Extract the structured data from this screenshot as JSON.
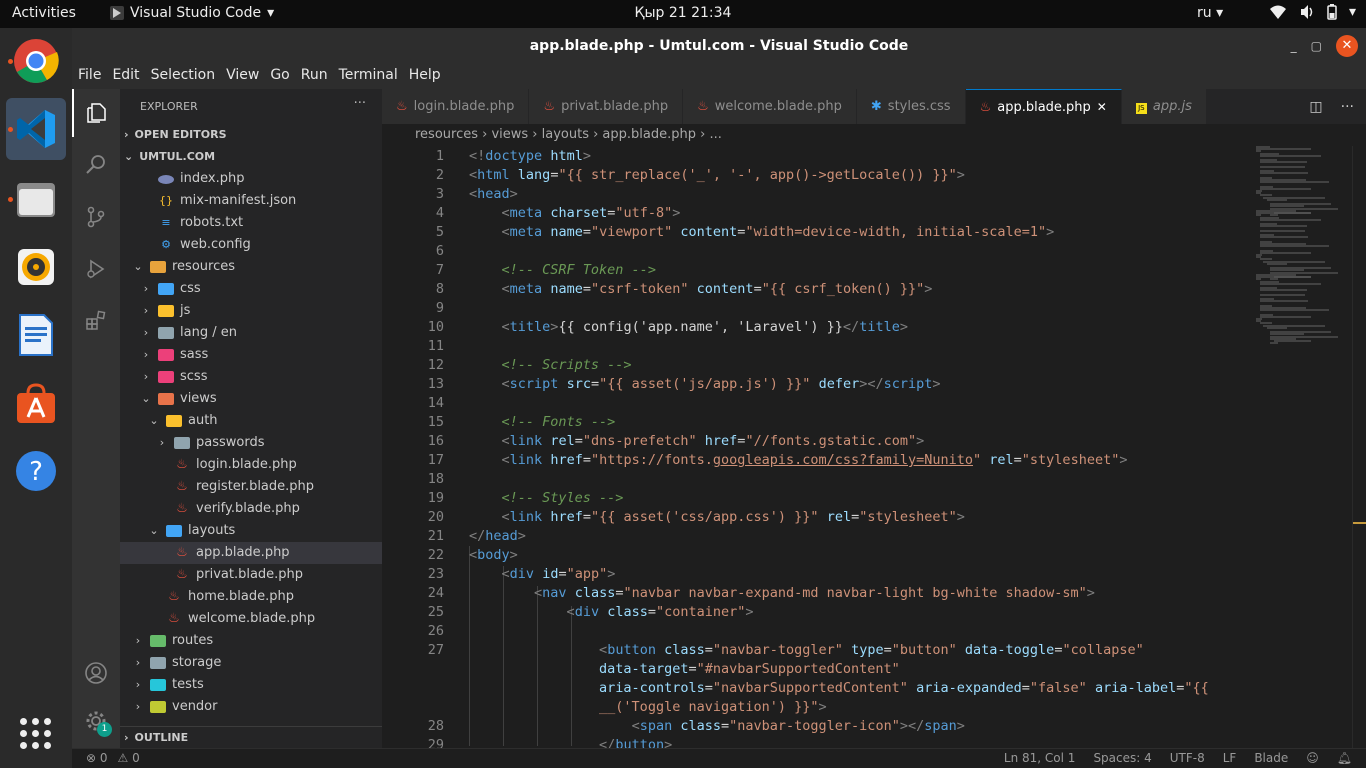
{
  "topbar": {
    "activities": "Activities",
    "app_name": "Visual Studio Code",
    "clock": "Қыр 21  21:34",
    "lang": "ru"
  },
  "window": {
    "title": "app.blade.php - Umtul.com - Visual Studio Code"
  },
  "menu": [
    "File",
    "Edit",
    "Selection",
    "View",
    "Go",
    "Run",
    "Terminal",
    "Help"
  ],
  "sidebar": {
    "header": "EXPLORER",
    "more": "···",
    "open_editors": "OPEN EDITORS",
    "project": "UMTUL.COM",
    "outline": "OUTLINE",
    "settings_badge": "1",
    "tree": [
      {
        "label": "index.php",
        "indent": 1,
        "type": "php"
      },
      {
        "label": "mix-manifest.json",
        "indent": 1,
        "type": "json"
      },
      {
        "label": "robots.txt",
        "indent": 1,
        "type": "txt"
      },
      {
        "label": "web.config",
        "indent": 1,
        "type": "config"
      },
      {
        "label": "resources",
        "indent": 0,
        "type": "folder-open",
        "chev": "down",
        "color": "#e8a33c"
      },
      {
        "label": "css",
        "indent": 1,
        "type": "folder",
        "chev": "right",
        "color": "#42a5f5"
      },
      {
        "label": "js",
        "indent": 1,
        "type": "folder",
        "chev": "right",
        "color": "#fbc02d"
      },
      {
        "label": "lang / en",
        "indent": 1,
        "type": "folder",
        "chev": "right",
        "color": "#90a4ae"
      },
      {
        "label": "sass",
        "indent": 1,
        "type": "folder",
        "chev": "right",
        "color": "#ec407a"
      },
      {
        "label": "scss",
        "indent": 1,
        "type": "folder",
        "chev": "right",
        "color": "#ec407a"
      },
      {
        "label": "views",
        "indent": 1,
        "type": "folder-open",
        "chev": "down",
        "color": "#e8734a"
      },
      {
        "label": "auth",
        "indent": 2,
        "type": "folder-open",
        "chev": "down",
        "color": "#fbc02d"
      },
      {
        "label": "passwords",
        "indent": 3,
        "type": "folder",
        "chev": "right",
        "color": "#90a4ae"
      },
      {
        "label": "login.blade.php",
        "indent": 3,
        "type": "blade"
      },
      {
        "label": "register.blade.php",
        "indent": 3,
        "type": "blade"
      },
      {
        "label": "verify.blade.php",
        "indent": 3,
        "type": "blade"
      },
      {
        "label": "layouts",
        "indent": 2,
        "type": "folder-open",
        "chev": "down",
        "color": "#42a5f5"
      },
      {
        "label": "app.blade.php",
        "indent": 3,
        "type": "blade",
        "selected": true
      },
      {
        "label": "privat.blade.php",
        "indent": 3,
        "type": "blade"
      },
      {
        "label": "home.blade.php",
        "indent": 2,
        "type": "blade"
      },
      {
        "label": "welcome.blade.php",
        "indent": 2,
        "type": "blade"
      },
      {
        "label": "routes",
        "indent": 0,
        "type": "folder",
        "chev": "right",
        "color": "#66bb6a"
      },
      {
        "label": "storage",
        "indent": 0,
        "type": "folder",
        "chev": "right",
        "color": "#90a4ae"
      },
      {
        "label": "tests",
        "indent": 0,
        "type": "folder",
        "chev": "right",
        "color": "#26c6da"
      },
      {
        "label": "vendor",
        "indent": 0,
        "type": "folder",
        "chev": "right",
        "color": "#c0ca33"
      }
    ]
  },
  "tabs": [
    {
      "label": "login.blade.php",
      "icon": "blade"
    },
    {
      "label": "privat.blade.php",
      "icon": "blade"
    },
    {
      "label": "welcome.blade.php",
      "icon": "blade"
    },
    {
      "label": "styles.css",
      "icon": "css"
    },
    {
      "label": "app.blade.php",
      "icon": "blade",
      "active": true
    },
    {
      "label": "app.js",
      "icon": "js",
      "italic": true
    }
  ],
  "breadcrumb": "resources › views › layouts › app.blade.php › ...",
  "code": [
    {
      "n": "1",
      "h": "<span class='p'>&lt;!</span><span class='t'>doctype</span> <span class='a'>html</span><span class='p'>&gt;</span>"
    },
    {
      "n": "2",
      "h": "<span class='p'>&lt;</span><span class='t'>html</span> <span class='a'>lang</span>=<span class='s'>\"{{ str_replace('_', '-', app()-&gt;getLocale()) }}\"</span><span class='p'>&gt;</span>"
    },
    {
      "n": "3",
      "h": "<span class='p'>&lt;</span><span class='t'>head</span><span class='p'>&gt;</span>"
    },
    {
      "n": "4",
      "h": "    <span class='p'>&lt;</span><span class='t'>meta</span> <span class='a'>charset</span>=<span class='s'>\"utf-8\"</span><span class='p'>&gt;</span>"
    },
    {
      "n": "5",
      "h": "    <span class='p'>&lt;</span><span class='t'>meta</span> <span class='a'>name</span>=<span class='s'>\"viewport\"</span> <span class='a'>content</span>=<span class='s'>\"width=device-width, initial-scale=1\"</span><span class='p'>&gt;</span>"
    },
    {
      "n": "6",
      "h": ""
    },
    {
      "n": "7",
      "h": "    <span class='c'>&lt;!-- CSRF Token --&gt;</span>"
    },
    {
      "n": "8",
      "h": "    <span class='p'>&lt;</span><span class='t'>meta</span> <span class='a'>name</span>=<span class='s'>\"csrf-token\"</span> <span class='a'>content</span>=<span class='s'>\"{{ csrf_token() }}\"</span><span class='p'>&gt;</span>"
    },
    {
      "n": "9",
      "h": ""
    },
    {
      "n": "10",
      "h": "    <span class='p'>&lt;</span><span class='t'>title</span><span class='p'>&gt;</span>{{ config('app.name', 'Laravel') }}<span class='p'>&lt;/</span><span class='t'>title</span><span class='p'>&gt;</span>"
    },
    {
      "n": "11",
      "h": ""
    },
    {
      "n": "12",
      "h": "    <span class='c'>&lt;!-- Scripts --&gt;</span>"
    },
    {
      "n": "13",
      "h": "    <span class='p'>&lt;</span><span class='t'>script</span> <span class='a'>src</span>=<span class='s'>\"{{ asset('js/app.js') }}\"</span> <span class='a'>defer</span><span class='p'>&gt;&lt;/</span><span class='t'>script</span><span class='p'>&gt;</span>"
    },
    {
      "n": "14",
      "h": ""
    },
    {
      "n": "15",
      "h": "    <span class='c'>&lt;!-- Fonts --&gt;</span>"
    },
    {
      "n": "16",
      "h": "    <span class='p'>&lt;</span><span class='t'>link</span> <span class='a'>rel</span>=<span class='s'>\"dns-prefetch\"</span> <span class='a'>href</span>=<span class='s'>\"//fonts.gstatic.com\"</span><span class='p'>&gt;</span>"
    },
    {
      "n": "17",
      "h": "    <span class='p'>&lt;</span><span class='t'>link</span> <span class='a'>href</span>=<span class='s'>\"https://fonts.<span class='u'>googleapis.com/css?family=Nunito</span>\"</span> <span class='a'>rel</span>=<span class='s'>\"stylesheet\"</span><span class='p'>&gt;</span>"
    },
    {
      "n": "18",
      "h": ""
    },
    {
      "n": "19",
      "h": "    <span class='c'>&lt;!-- Styles --&gt;</span>"
    },
    {
      "n": "20",
      "h": "    <span class='p'>&lt;</span><span class='t'>link</span> <span class='a'>href</span>=<span class='s'>\"{{ asset('css/app.css') }}\"</span> <span class='a'>rel</span>=<span class='s'>\"stylesheet\"</span><span class='p'>&gt;</span>"
    },
    {
      "n": "21",
      "h": "<span class='p'>&lt;/</span><span class='t'>head</span><span class='p'>&gt;</span>"
    },
    {
      "n": "22",
      "h": "<span class='p'>&lt;</span><span class='t'>body</span><span class='p'>&gt;</span>"
    },
    {
      "n": "23",
      "h": "    <span class='p'>&lt;</span><span class='t'>div</span> <span class='a'>id</span>=<span class='s'>\"app\"</span><span class='p'>&gt;</span>"
    },
    {
      "n": "24",
      "h": "        <span class='p'>&lt;</span><span class='t'>nav</span> <span class='a'>class</span>=<span class='s'>\"navbar navbar-expand-md navbar-light bg-white shadow-sm\"</span><span class='p'>&gt;</span>"
    },
    {
      "n": "25",
      "h": "            <span class='p'>&lt;</span><span class='t'>div</span> <span class='a'>class</span>=<span class='s'>\"container\"</span><span class='p'>&gt;</span>"
    },
    {
      "n": "26",
      "h": ""
    },
    {
      "n": "27",
      "h": "                <span class='p'>&lt;</span><span class='t'>button</span> <span class='a'>class</span>=<span class='s'>\"navbar-toggler\"</span> <span class='a'>type</span>=<span class='s'>\"button\"</span> <span class='a'>data-toggle</span>=<span class='s'>\"collapse\"</span>"
    },
    {
      "n": "",
      "h": "                <span class='a'>data-target</span>=<span class='s'>\"#navbarSupportedContent\"</span>"
    },
    {
      "n": "",
      "h": "                <span class='a'>aria-controls</span>=<span class='s'>\"navbarSupportedContent\"</span> <span class='a'>aria-expanded</span>=<span class='s'>\"false\"</span> <span class='a'>aria-label</span>=<span class='s'>\"{{</span>"
    },
    {
      "n": "",
      "h": "                <span class='s'>__('Toggle navigation') }}\"</span><span class='p'>&gt;</span>"
    },
    {
      "n": "28",
      "h": "                    <span class='p'>&lt;</span><span class='t'>span</span> <span class='a'>class</span>=<span class='s'>\"navbar-toggler-icon\"</span><span class='p'>&gt;&lt;/</span><span class='t'>span</span><span class='p'>&gt;</span>"
    },
    {
      "n": "29",
      "h": "                <span class='p'>&lt;/</span><span class='t'>button</span><span class='p'>&gt;</span>"
    }
  ],
  "status": {
    "errors": "⊗ 0",
    "warnings": "⚠ 0",
    "position": "Ln 81, Col 1",
    "spaces": "Spaces: 4",
    "encoding": "UTF-8",
    "eol": "LF",
    "language": "Blade"
  }
}
